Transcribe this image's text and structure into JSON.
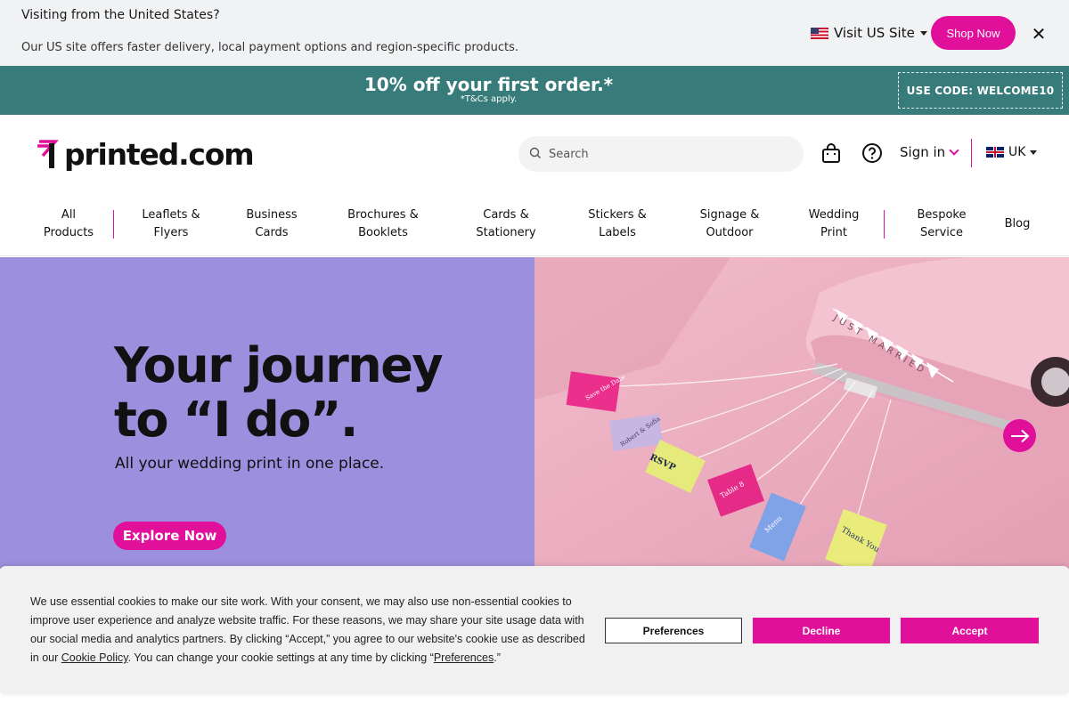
{
  "geo_banner": {
    "title": "Visiting from the United States?",
    "subtitle": "Our US site offers faster delivery, local payment options and region-specific products.",
    "visit_label": "Visit US Site",
    "shop_now_label": "Shop Now",
    "close_icon": "close-icon"
  },
  "promo": {
    "headline": "10% off your first order.*",
    "terms": "*T&Cs apply.",
    "code_label": "USE CODE: WELCOME10"
  },
  "header": {
    "logo_text": "printed.com",
    "search_placeholder": "Search",
    "basket_icon": "shopping-bag-icon",
    "help_icon": "help-icon",
    "signin_label": "Sign in",
    "locale_label": "UK"
  },
  "nav": {
    "items": [
      {
        "label": "All\nProducts"
      },
      {
        "label": "Leaflets &\nFlyers"
      },
      {
        "label": "Business\nCards"
      },
      {
        "label": "Brochures &\nBooklets"
      },
      {
        "label": "Cards &\nStationery"
      },
      {
        "label": "Stickers &\nLabels"
      },
      {
        "label": "Signage &\nOutdoor"
      },
      {
        "label": "Wedding\nPrint"
      },
      {
        "label": "Bespoke\nService"
      },
      {
        "label": "Blog"
      }
    ]
  },
  "hero": {
    "title": "Your journey to “I do”.",
    "subtitle": "All your wedding print in one place.",
    "cta_label": "Explore Now",
    "next_icon": "arrow-right-icon",
    "image_labels": [
      "JUST MARRIED",
      "Save the Date",
      "Robert & Sofia",
      "RSVP",
      "Table 8",
      "Menu",
      "Thank You"
    ],
    "colors": {
      "left_bg": "#9c8fdd",
      "right_bg": "#e8a9b9",
      "accent": "#e0109b"
    }
  },
  "cookie": {
    "text_before_link": "We use essential cookies to make our site work. With your consent, we may also use non-essential cookies to improve user experience and analyze website traffic. For these reasons, we may share your site usage data with our social media and analytics partners. By clicking “Accept,” you agree to our website's cookie use as described in our ",
    "policy_link": "Cookie Policy",
    "text_middle": ". You can change your cookie settings at any time by clicking “",
    "preferences_link": "Preferences",
    "text_end": ".”",
    "preferences_label": "Preferences",
    "decline_label": "Decline",
    "accept_label": "Accept"
  }
}
